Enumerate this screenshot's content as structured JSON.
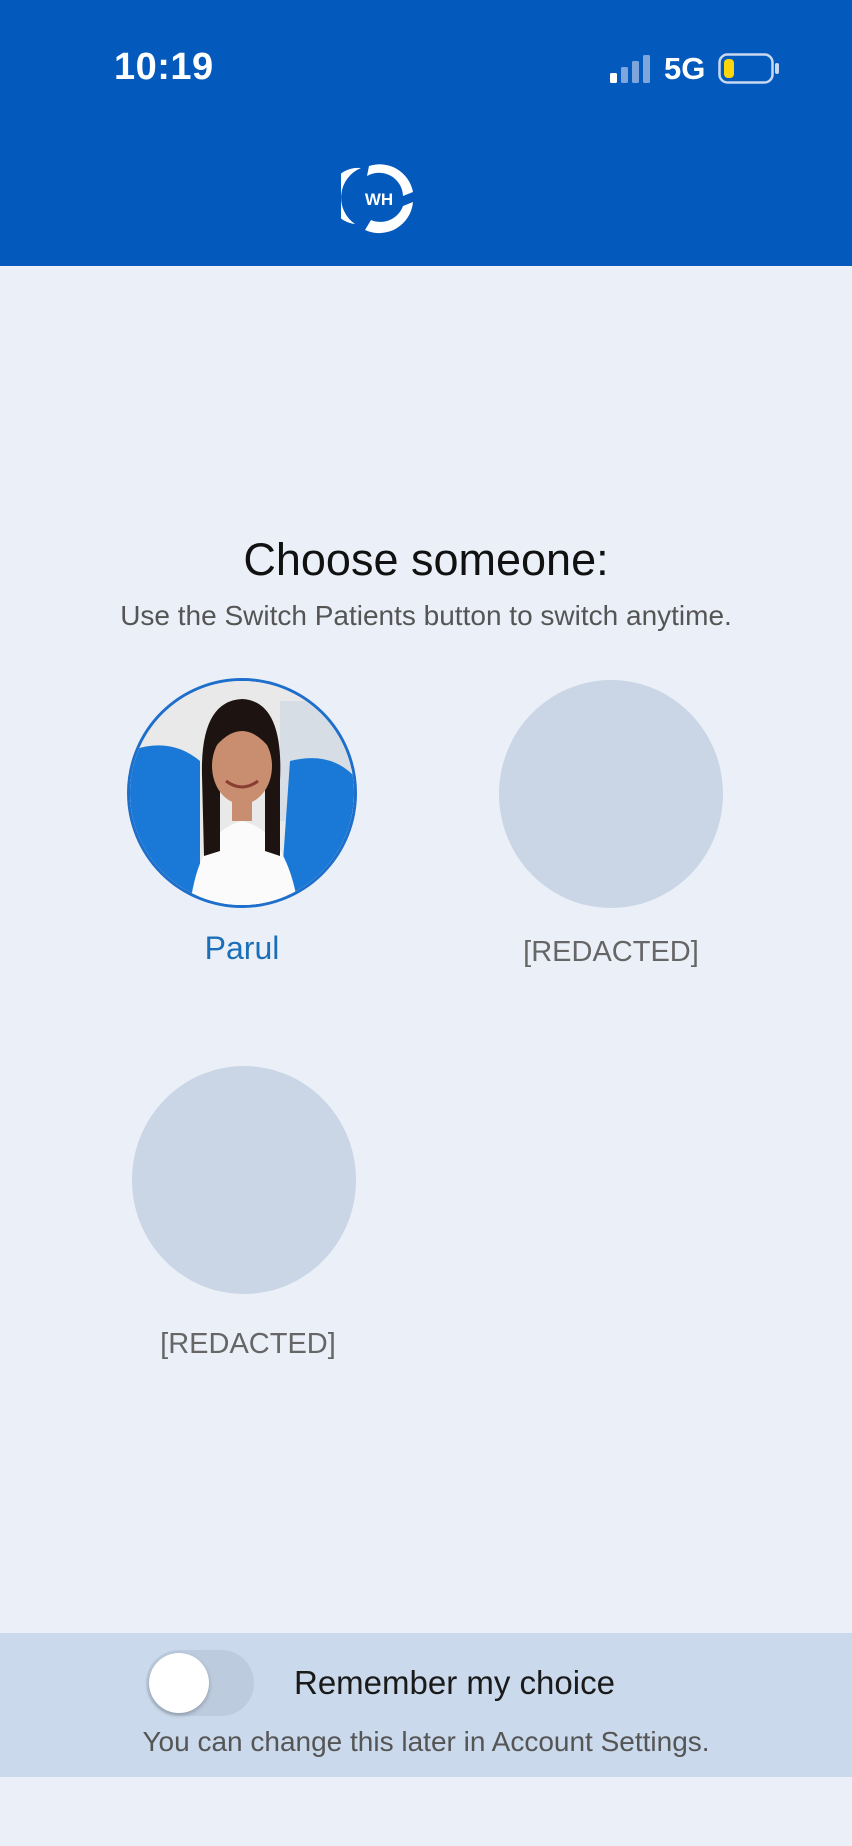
{
  "status_bar": {
    "time": "10:19",
    "network": "5G",
    "signal_bars_filled": 1,
    "battery_level": "low"
  },
  "header": {
    "logo_text": "WH",
    "logo_icon": "wh-logo-icon",
    "background_color": "#0359bc"
  },
  "main": {
    "title": "Choose someone:",
    "subtitle": "Use the Switch Patients button to switch anytime."
  },
  "patients": [
    {
      "name": "Parul",
      "selected": true,
      "has_photo": true
    },
    {
      "name": "[REDACTED]",
      "selected": false,
      "has_photo": false
    },
    {
      "name": "[REDACTED]",
      "selected": false,
      "has_photo": false
    }
  ],
  "footer": {
    "remember_label": "Remember my choice",
    "remember_enabled": false,
    "note": "You can change this later in Account Settings."
  },
  "colors": {
    "accent": "#1b6fb8",
    "placeholder": "#cad6e5",
    "footer_bg": "#cad9eb"
  }
}
